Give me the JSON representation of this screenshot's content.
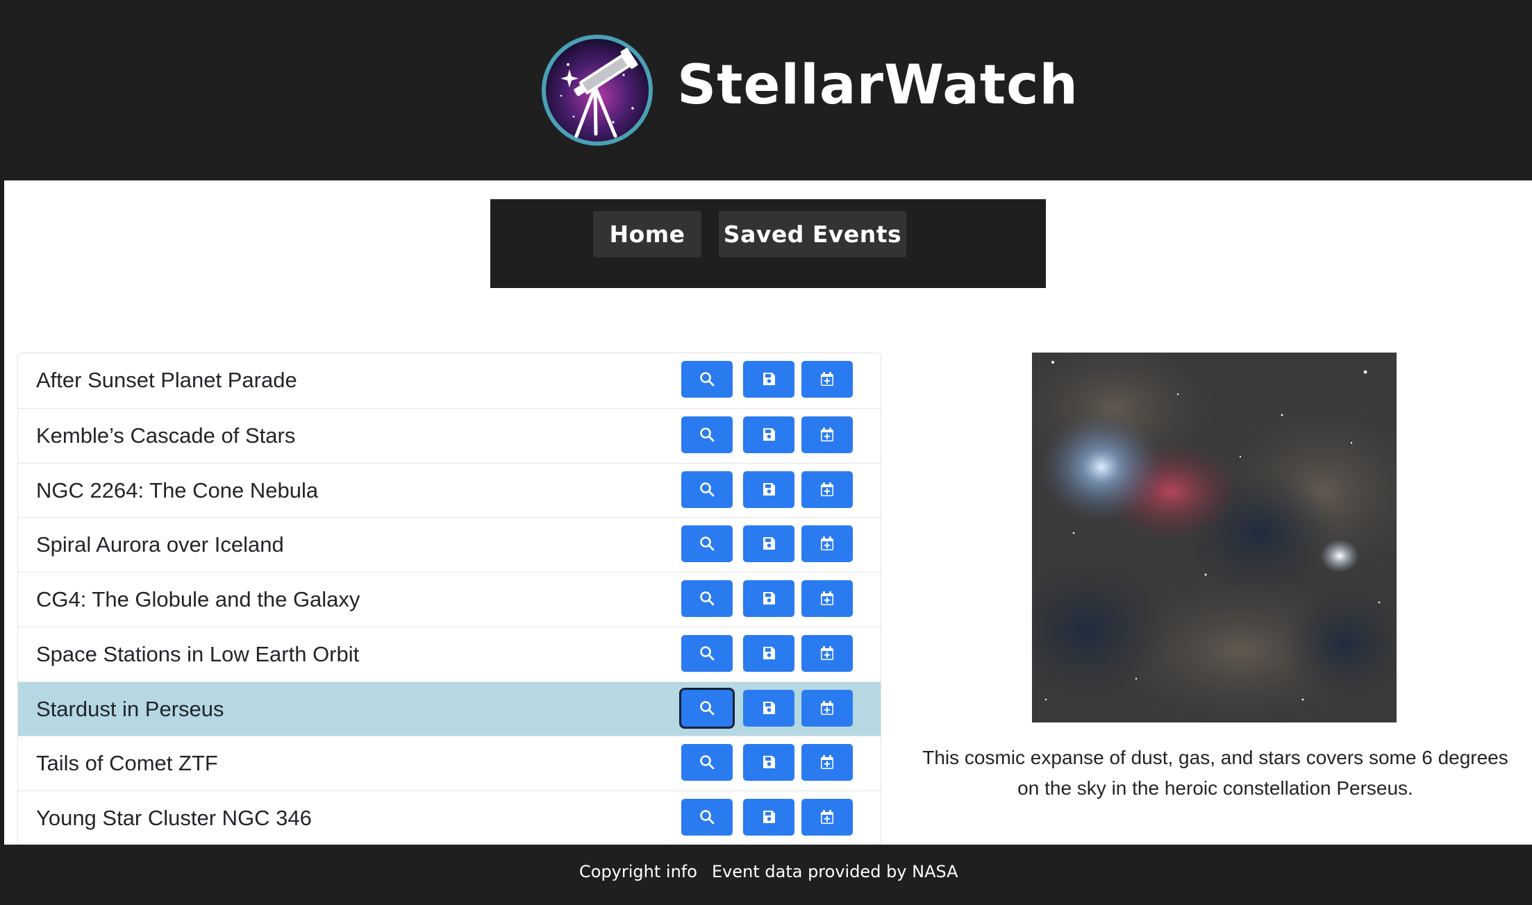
{
  "header": {
    "brand": "StellarWatch",
    "logo_icon": "telescope-logo-icon"
  },
  "nav": {
    "home_label": "Home",
    "saved_label": "Saved Events"
  },
  "events": [
    {
      "title": "After Sunset Planet Parade"
    },
    {
      "title": "Kemble’s Cascade of Stars"
    },
    {
      "title": "NGC 2264: The Cone Nebula"
    },
    {
      "title": "Spiral Aurora over Iceland"
    },
    {
      "title": "CG4: The Globule and the Galaxy"
    },
    {
      "title": "Space Stations in Low Earth Orbit"
    },
    {
      "title": "Stardust in Perseus",
      "selected": true
    },
    {
      "title": "Tails of Comet ZTF"
    },
    {
      "title": "Young Star Cluster NGC 346"
    }
  ],
  "row_actions": [
    {
      "name": "view-button",
      "icon": "search-icon"
    },
    {
      "name": "save-button",
      "icon": "floppy-disk-icon"
    },
    {
      "name": "add-to-calendar-button",
      "icon": "calendar-plus-icon"
    }
  ],
  "detail": {
    "image_alt": "Stardust in Perseus nebula image",
    "caption": "This cosmic expanse of dust, gas, and stars covers some 6 degrees on the sky in the heroic constellation Perseus."
  },
  "footer": {
    "copyright": "Copyright info",
    "credit": "Event data provided by NASA"
  },
  "colors": {
    "dark": "#1f1f1f",
    "button_blue": "#2b7bf0",
    "selected_row": "#b5d8e3"
  }
}
